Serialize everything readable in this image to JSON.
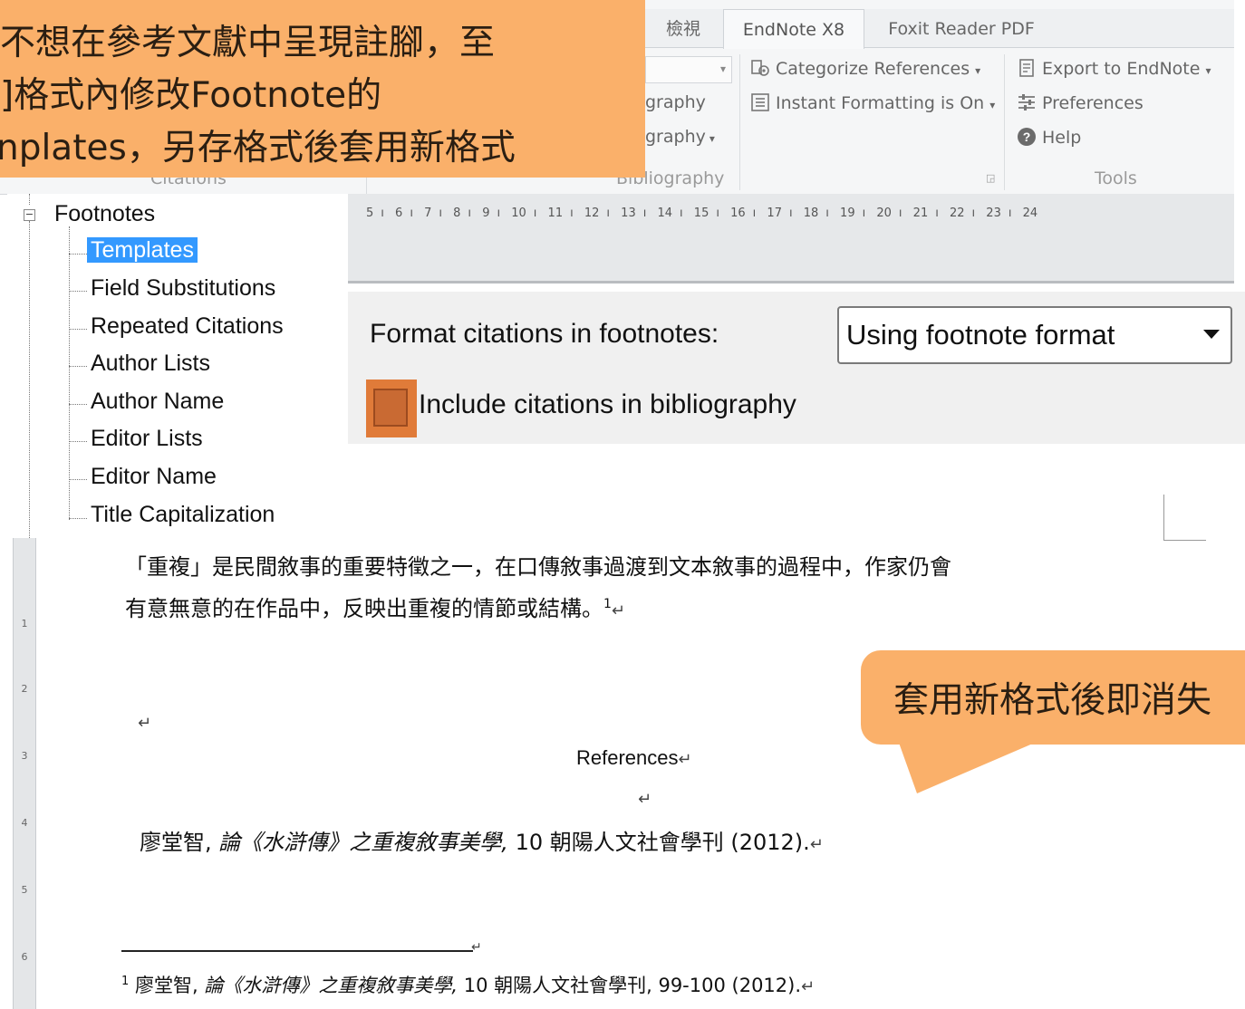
{
  "ribbon": {
    "tabs": [
      "檢視",
      "EndNote X8",
      "Foxit Reader PDF"
    ],
    "active_tab": "EndNote X8",
    "bibliography": {
      "categorize": "Categorize References",
      "instant": "Instant Formatting is On",
      "partial1": "graphy",
      "partial2": "graphy",
      "label": "Bibliography"
    },
    "tools": {
      "export": "Export to EndNote",
      "preferences": "Preferences",
      "help": "Help",
      "label": "Tools"
    },
    "citations_label": "Citations"
  },
  "callout_top": {
    "line1": "不想在參考文獻中呈現註腳，至",
    "line2": "]格式內修改Footnote的",
    "line3": "nplates，另存格式後套用新格式"
  },
  "tree": {
    "root": "Footnotes",
    "items": [
      "Templates",
      "Field Substitutions",
      "Repeated Citations",
      "Author Lists",
      "Author Name",
      "Editor Lists",
      "Editor Name",
      "Title Capitalization"
    ]
  },
  "ruler": {
    "ticks": [
      "5",
      "6",
      "7",
      "8",
      "9",
      "10",
      "11",
      "12",
      "13",
      "14",
      "15",
      "16",
      "17",
      "18",
      "19",
      "20",
      "21",
      "22",
      "23",
      "24"
    ]
  },
  "format": {
    "label": "Format citations in footnotes:",
    "select_value": "Using footnote format",
    "checkbox_label": "Include citations in bibliography",
    "checkbox_checked": false
  },
  "document": {
    "para_line1": "「重複」是民間敘事的重要特徵之一，在口傳敘事過渡到文本敘事的過程中，作家仍會",
    "para_line2": "有意無意的在作品中，反映出重複的情節或結構。",
    "footnote_ref": "1",
    "references_heading": "References",
    "ref_author": "廖堂智,",
    "ref_title": "論《水滸傳》之重複敘事美學,",
    "ref_rest": "10  朝陽人文社會學刊  (2012).",
    "footnote_num": "1",
    "fn_author": "廖堂智,",
    "fn_title": "論《水滸傳》之重複敘事美學,",
    "fn_rest": "10  朝陽人文社會學刊, 99-100 (2012).",
    "para_mark": "↵",
    "vruler_marks": [
      "1",
      "2",
      "3",
      "4",
      "5",
      "6"
    ]
  },
  "callout_bottom": {
    "text": "套用新格式後即消失"
  }
}
